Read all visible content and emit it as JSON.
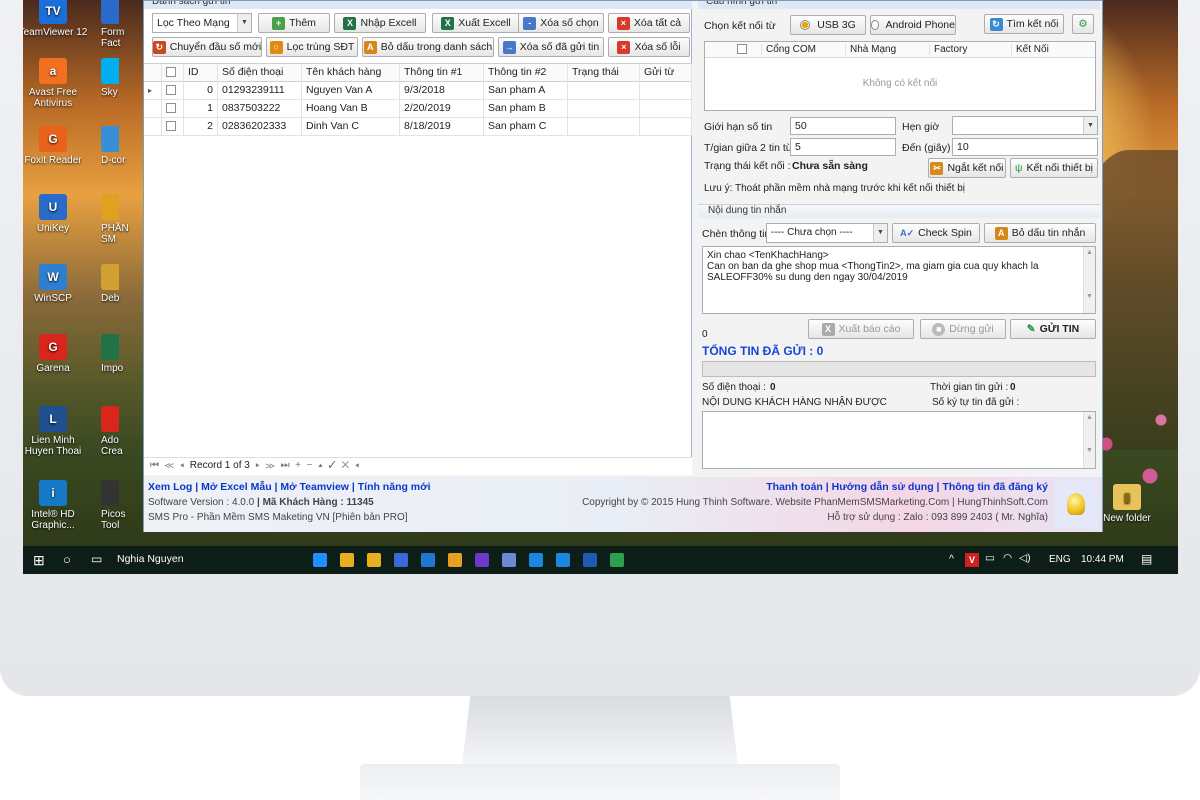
{
  "desktop": {
    "left_icons": [
      {
        "name": "teamviewer",
        "label": "TeamViewer 12",
        "color": "#1b6fd8",
        "glyph": "TV"
      },
      {
        "name": "avast",
        "label": "Avast Free Antivirus",
        "color": "#f37021",
        "glyph": "a"
      },
      {
        "name": "foxit",
        "label": "Foxit Reader",
        "color": "#e8621a",
        "glyph": "G"
      },
      {
        "name": "unikey",
        "label": "UniKey",
        "color": "#2a6bc9",
        "glyph": "U"
      },
      {
        "name": "winscp",
        "label": "WinSCP",
        "color": "#2f7fd1",
        "glyph": "W"
      },
      {
        "name": "garena",
        "label": "Garena",
        "color": "#d9261c",
        "glyph": "G"
      },
      {
        "name": "lienminh",
        "label": "Lien Minh Huyen Thoai",
        "color": "#1f4f8f",
        "glyph": "L"
      },
      {
        "name": "intel",
        "label": "Intel® HD Graphic...",
        "color": "#1679c8",
        "glyph": "i"
      }
    ],
    "partial_icons": [
      {
        "label": "Form Fact",
        "color": "#2a6bc9"
      },
      {
        "label": "Sky",
        "color": "#00aff0"
      },
      {
        "label": "D-cor",
        "color": "#3a8ed6"
      },
      {
        "label": "PHẦN SM",
        "color": "#e0a020"
      },
      {
        "label": "Deb",
        "color": "#d0a030"
      },
      {
        "label": "Impo",
        "color": "#217346"
      },
      {
        "label": "Ado Crea",
        "color": "#d8261c"
      },
      {
        "label": "Picos Tool",
        "color": "#333333"
      }
    ],
    "right_icon": {
      "label": "New folder"
    }
  },
  "top_cut": {
    "left": "Danh sách gửi tin",
    "right": "Cấu hình gửi tin"
  },
  "left": {
    "filter_select": "Lọc Theo Mạng",
    "buttons_row1": [
      {
        "name": "add-button",
        "label": "Thêm",
        "ic": "#4aa04a",
        "g": "+"
      },
      {
        "name": "import-excel-button",
        "label": "Nhập Excell",
        "ic": "#217346",
        "g": "X"
      },
      {
        "name": "export-excel-button",
        "label": "Xuất Excell",
        "ic": "#217346",
        "g": "X"
      },
      {
        "name": "delete-selected-button",
        "label": "Xóa số chọn",
        "ic": "#4a78c8",
        "g": "-"
      },
      {
        "name": "delete-all-button",
        "label": "Xóa tất cả",
        "ic": "#d83a2a",
        "g": "×"
      }
    ],
    "buttons_row2": [
      {
        "name": "change-prefix-button",
        "label": "Chuyển đầu số mới",
        "ic": "#c84a1a",
        "g": "↻"
      },
      {
        "name": "filter-duplicate-button",
        "label": "Lọc trùng SĐT",
        "ic": "#e08a10",
        "g": "○"
      },
      {
        "name": "remove-accents-button",
        "label": "Bỏ dấu trong danh sách",
        "ic": "#d8861a",
        "g": "A"
      },
      {
        "name": "delete-sent-button",
        "label": "Xóa số đã gửi tin",
        "ic": "#4a78c8",
        "g": "→"
      },
      {
        "name": "delete-error-button",
        "label": "Xóa số lỗi",
        "ic": "#d83a2a",
        "g": "×"
      }
    ],
    "columns": [
      "ID",
      "Số điện thoại",
      "Tên khách hàng",
      "Thông tin #1",
      "Thông tin #2",
      "Trạng thái",
      "Gửi từ"
    ],
    "rows": [
      {
        "id": "0",
        "phone": "01293239111",
        "name": "Nguyen Van A",
        "info1": "9/3/2018",
        "info2": "San pham A",
        "status": "",
        "from": ""
      },
      {
        "id": "1",
        "phone": "0837503222",
        "name": "Hoang Van B",
        "info1": "2/20/2019",
        "info2": "San pham B",
        "status": "",
        "from": ""
      },
      {
        "id": "2",
        "phone": "02836202333",
        "name": "Dinh Van C",
        "info1": "8/18/2019",
        "info2": "San pham C",
        "status": "",
        "from": ""
      }
    ],
    "nav_record": "Record 1 of 3"
  },
  "right": {
    "connect_label": "Chọn kết nối từ",
    "opt_usb": "USB 3G",
    "opt_android": "Android Phone",
    "find_button": "Tìm kết nối",
    "device_columns": [
      "Cổng COM",
      "Nhà Mạng",
      "Factory",
      "Kết Nối"
    ],
    "device_empty": "Không có kết nối",
    "limit_label": "Giới hạn số tin",
    "limit_value": "50",
    "schedule_label": "Hẹn giờ",
    "schedule_value": "",
    "interval_label": "T/gian giữa 2 tin từ",
    "interval_from": "5",
    "to_label": "Đến (giây)",
    "interval_to": "10",
    "status_label": "Trạng thái kết nối :",
    "status_value": "Chưa sẵn sàng",
    "disconnect_button": "Ngắt kết nối",
    "connect_button": "Kết nối thiết bị",
    "note": "Lưu ý: Thoát phần mềm nhà mạng trước khi kết nối thiết bị",
    "content_title": "Nội dung tin nhắn",
    "insert_label": "Chèn thông tin",
    "insert_select": "---- Chưa chọn ----",
    "check_spin_button": "Check Spin",
    "remove_accent_button": "Bỏ dấu tin nhắn",
    "message_lines": [
      "Xin chao <TenKhachHang>",
      "Can on ban da ghe shop mua <ThongTin2>, ma giam gia cua quy khach la",
      "SALEOFF30% su dung den ngay 30/04/2019"
    ],
    "char_count": "0",
    "report_button": "Xuất báo cáo",
    "stop_button": "Dừng gửi",
    "send_button": "GỬI TIN",
    "total_sent": "TỔNG TIN ĐÃ GỬI : 0",
    "phone_label": "Số điện thoại :",
    "phone_value": "0",
    "time_label": "Thời gian tin gửi :",
    "time_value": "0",
    "received_label": "NỘI DUNG KHÁCH HÀNG NHẬN ĐƯỢC",
    "chars_label": "Số ký tự tin đã gửi :"
  },
  "footer": {
    "links_left": [
      "Xem Log",
      "Mở Excel Mẫu",
      "Mở Teamview",
      "Tính năng mới"
    ],
    "version_label": "Software Version :",
    "version": "4.0.0",
    "customer_label": "Mã Khách Hàng :",
    "customer": "11345",
    "product": "SMS Pro - Phần Mềm SMS Maketing VN [Phiên bản PRO]",
    "links_right": [
      "Thanh toán",
      "Hướng dẫn sử dụng",
      "Thông tin đã đăng ký"
    ],
    "copyright": "Copyright by © 2015 Hung Thinh Software. Website PhanMemSMSMarketing.Com | HungThinhSoft.Com",
    "support": "Hỗ trợ sử dụng : Zalo : 093 899 2403 ( Mr. Nghĩa)"
  },
  "taskbar": {
    "user": "Nghia Nguyen",
    "apps": [
      "#1e90ff",
      "#e8b020",
      "#e8b020",
      "#3a6ad8",
      "#1e78d0",
      "#e8a020",
      "#6a3ac8",
      "#6a8ad8",
      "#1a88e0",
      "#1a88e0",
      "#1e5ab0",
      "#2aa050"
    ],
    "lang": "ENG",
    "time": "10:44 PM"
  }
}
